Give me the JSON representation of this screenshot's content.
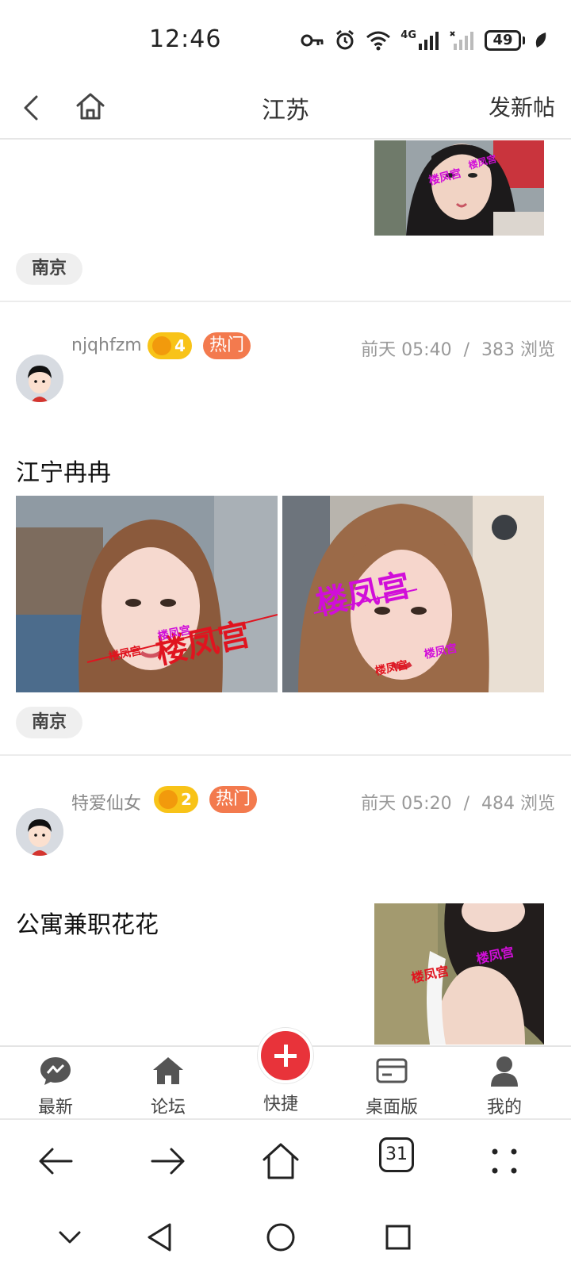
{
  "status": {
    "time": "12:46",
    "network": "4G",
    "battery": "49"
  },
  "header": {
    "title": "江苏",
    "new_post_label": "发新帖"
  },
  "posts": [
    {
      "tag": "南京"
    },
    {
      "author": "njqhfzm",
      "level": "4",
      "hot_label": "热门",
      "date": "前天 05:40",
      "separator": "/",
      "views": "383 浏览",
      "title": "江宁冉冉",
      "watermark": "楼凤宫",
      "tag": "南京"
    },
    {
      "author": "特爱仙女",
      "level": "2",
      "hot_label": "热门",
      "date": "前天 05:20",
      "separator": "/",
      "views": "484 浏览",
      "title": "公寓兼职花花",
      "watermark": "楼凤宫"
    }
  ],
  "tabbar": {
    "items": [
      {
        "label": "最新",
        "icon": "chat-bubble-icon"
      },
      {
        "label": "论坛",
        "icon": "home-icon"
      },
      {
        "label": "快捷",
        "icon": "plus-icon"
      },
      {
        "label": "桌面版",
        "icon": "desktop-card-icon"
      },
      {
        "label": "我的",
        "icon": "user-icon"
      }
    ]
  },
  "browser": {
    "tab_count": "31"
  },
  "colors": {
    "accent_red": "#e8333a",
    "hot_badge": "#f37a4e",
    "level_badge": "#f8c318",
    "watermark_magenta": "#d10ed9"
  }
}
